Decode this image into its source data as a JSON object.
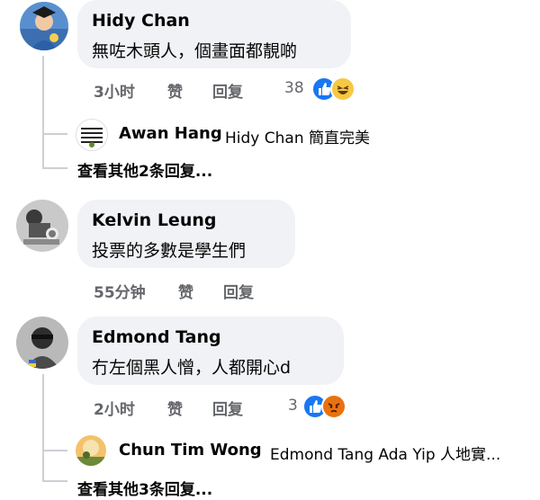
{
  "comments": [
    {
      "author": "Hidy Chan",
      "text": "無咗木頭人，個畫面都靚啲",
      "time": "3小时",
      "like_label": "赞",
      "reply_label": "回复",
      "reaction_count": "38",
      "reactions": [
        "like-icon",
        "haha-icon"
      ],
      "replies": [
        {
          "author": "Awan Hang",
          "text": "Hidy Chan 簡直完美"
        }
      ],
      "more_replies": "查看其他2条回复..."
    },
    {
      "author": "Kelvin Leung",
      "text": "投票的多數是學生們",
      "time": "55分钟",
      "like_label": "赞",
      "reply_label": "回复"
    },
    {
      "author": "Edmond Tang",
      "text": "冇左個黑人憎，人都開心d",
      "time": "2小时",
      "like_label": "赞",
      "reply_label": "回复",
      "reaction_count": "3",
      "reactions": [
        "like-icon",
        "angry-icon"
      ],
      "replies": [
        {
          "author": "Chun Tim Wong",
          "text": "Edmond Tang Ada Yip 人地實..."
        }
      ],
      "more_replies": "查看其他3条回复..."
    }
  ],
  "colors": {
    "bubble": "#f0f2f5",
    "like_blue": "#1877f2",
    "meta_gray": "#65676b"
  }
}
